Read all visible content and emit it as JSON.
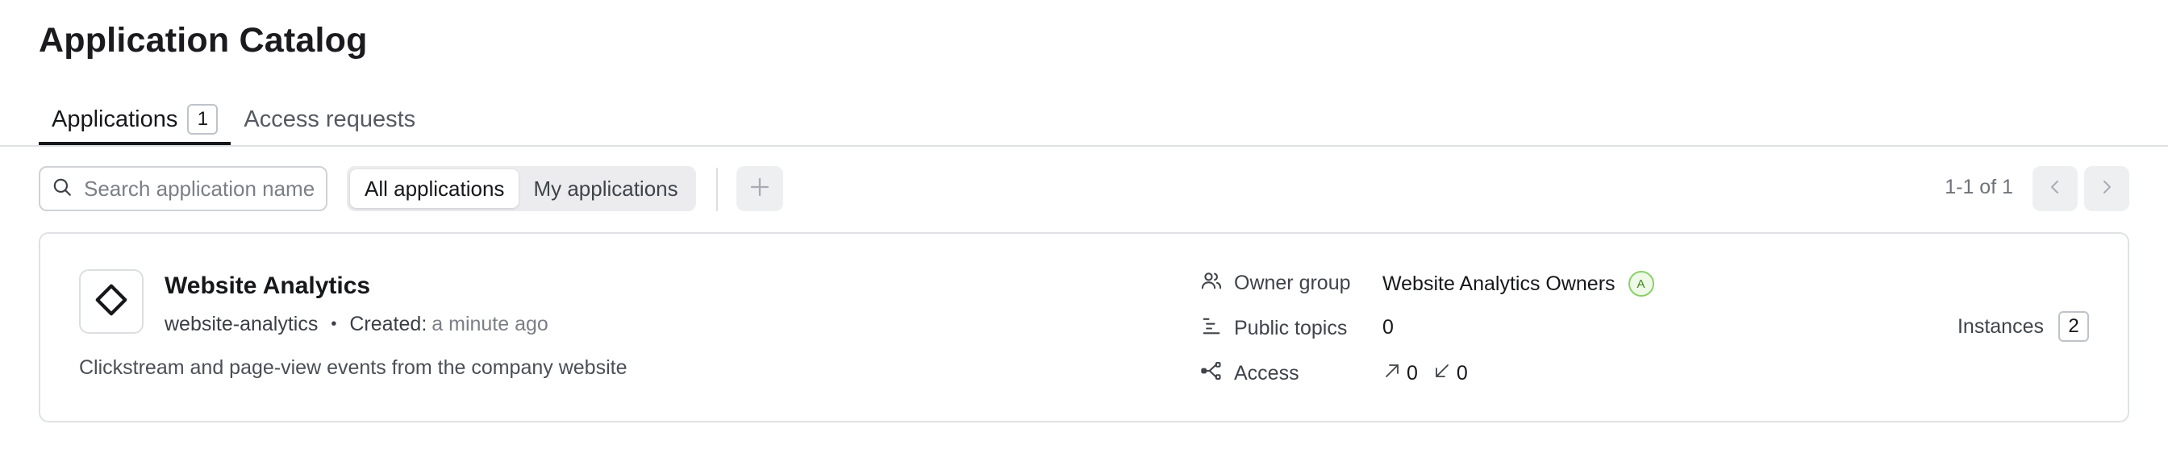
{
  "page": {
    "title": "Application Catalog"
  },
  "tabs": [
    {
      "label": "Applications",
      "count": "1",
      "active": true
    },
    {
      "label": "Access requests",
      "active": false
    }
  ],
  "toolbar": {
    "search_placeholder": "Search application name",
    "filters": [
      {
        "label": "All applications",
        "active": true
      },
      {
        "label": "My applications",
        "active": false
      }
    ],
    "add_icon": "plus-icon",
    "pagination": {
      "text": "1-1 of 1",
      "prev_icon": "chevron-left-icon",
      "next_icon": "chevron-right-icon"
    }
  },
  "application": {
    "icon": "diamond-icon",
    "name": "Website Analytics",
    "slug": "website-analytics",
    "separator": "•",
    "created_label": "Created:",
    "created_value": "a minute ago",
    "description": "Clickstream and page-view events from the company website",
    "owner_group_label": "Owner group",
    "owner_group_value": "Website Analytics Owners",
    "owner_badge": "A",
    "public_topics_label": "Public topics",
    "public_topics_value": "0",
    "access_label": "Access",
    "access_out": "0",
    "access_in": "0",
    "instances_label": "Instances",
    "instances_value": "2"
  },
  "colors": {
    "text": "#16171a",
    "muted": "#7b7f86",
    "border": "#dfe1e4",
    "badge_green": "#8bd06b"
  }
}
